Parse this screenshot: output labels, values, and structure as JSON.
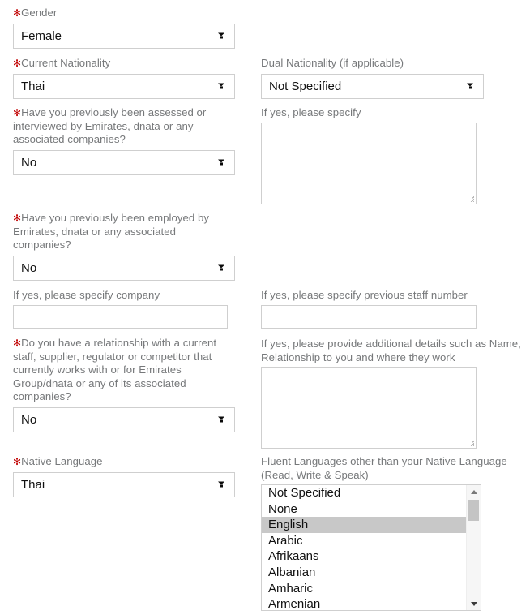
{
  "form": {
    "required_marker": "✻",
    "accent_required_color": "#c00000",
    "label_color": "#76787a",
    "border_color": "#cfcfcf",
    "highlight_color": "#c8c8c8",
    "fields": {
      "gender": {
        "label": "Gender",
        "value": "Female"
      },
      "current_nationality": {
        "label": "Current Nationality",
        "value": "Thai"
      },
      "dual_nationality": {
        "label": "Dual Nationality (if applicable)",
        "value": "Not Specified"
      },
      "previously_assessed": {
        "label": "Have you previously been assessed or interviewed by Emirates, dnata or any associated companies?",
        "value": "No"
      },
      "assessed_specify": {
        "label": "If yes, please specify",
        "value": ""
      },
      "previously_employed": {
        "label": "Have you previously been employed by Emirates, dnata or any associated companies?",
        "value": "No"
      },
      "employed_company": {
        "label": "If yes, please specify company",
        "value": ""
      },
      "previous_staff_number": {
        "label": "If yes, please specify previous staff number",
        "value": ""
      },
      "relationship": {
        "label": "Do you have a relationship with a current staff, supplier, regulator or competitor that currently works with or for Emirates Group/dnata or any of its associated companies?",
        "value": "No"
      },
      "relationship_details": {
        "label": "If yes, please provide additional details such as Name, Relationship to you and where they work",
        "value": ""
      },
      "native_language": {
        "label": "Native Language",
        "value": "Thai"
      },
      "fluent_languages": {
        "label": "Fluent Languages other than your Native Language (Read, Write & Speak)",
        "options": [
          "Not Specified",
          "None",
          "English",
          "Arabic",
          "Afrikaans",
          "Albanian",
          "Amharic",
          "Armenian"
        ],
        "selected": "English"
      }
    }
  }
}
